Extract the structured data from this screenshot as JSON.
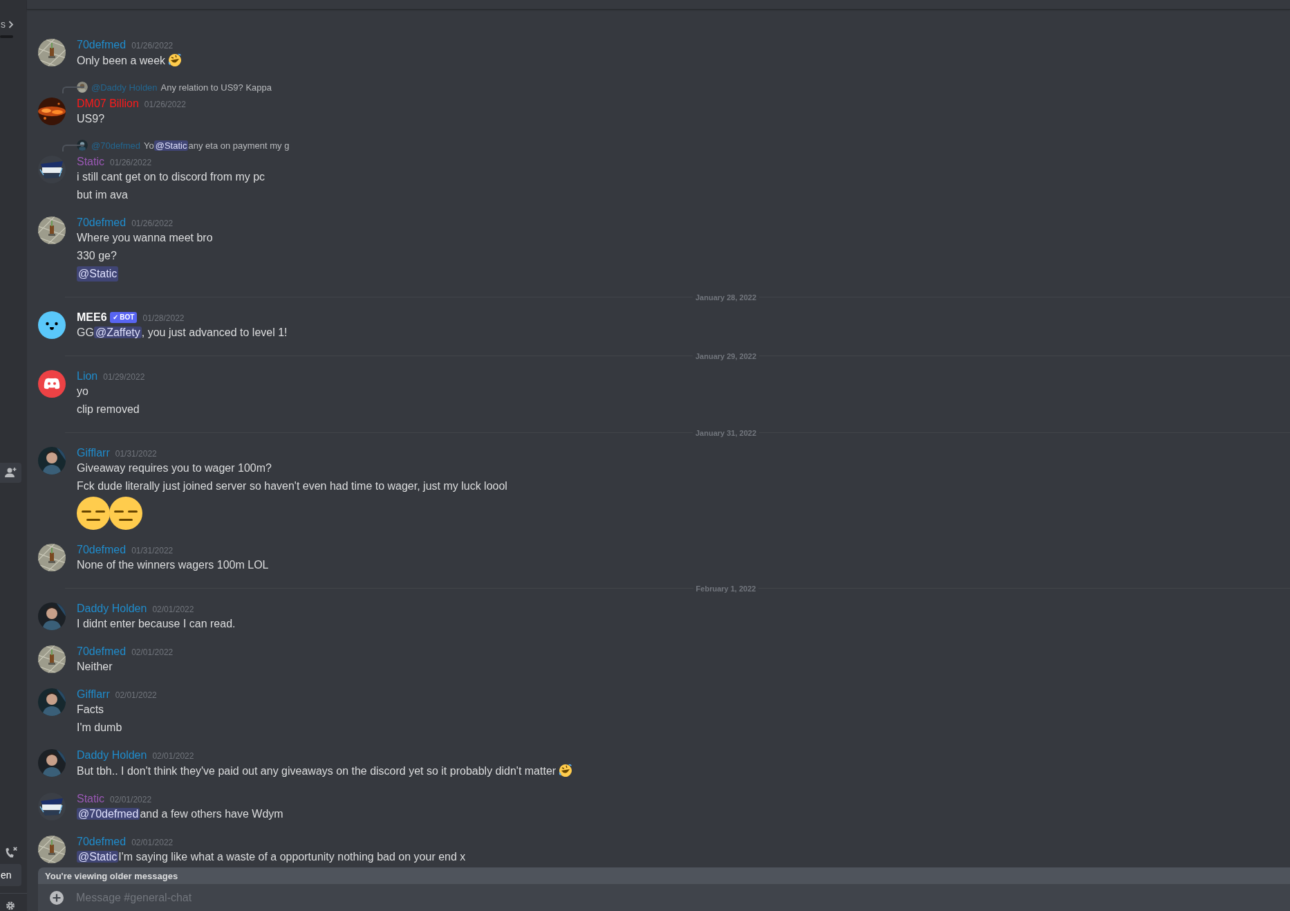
{
  "sidebar": {
    "header": "s",
    "footer_item": {
      "label": "en",
      "selected": true
    }
  },
  "messages": [
    {
      "kind": "message",
      "author": "70defmed",
      "color": "#1f8ccc",
      "timestamp": "01/26/2022",
      "avatar": {
        "kind": "picture"
      },
      "lines": [
        [
          {
            "kind": "text",
            "text": "Only been a week"
          },
          {
            "kind": "laugh_emoji"
          }
        ]
      ]
    },
    {
      "kind": "message",
      "author": "DM07 Billion",
      "color": "#ff1a1a",
      "timestamp": "01/26/2022",
      "avatar": {
        "kind": "picture"
      },
      "reply": {
        "author": "@Daddy Holden",
        "segments": [
          {
            "kind": "text",
            "text": "Any relation to US9? Kappa"
          }
        ]
      },
      "lines": [
        [
          {
            "kind": "text",
            "text": "US9?"
          }
        ]
      ]
    },
    {
      "kind": "message",
      "author": "Static",
      "color": "#9b59b6",
      "timestamp": "01/26/2022",
      "avatar": {
        "kind": "picture"
      },
      "reply": {
        "author": "@70defmed",
        "segments": [
          {
            "kind": "text",
            "text": "Yo"
          },
          {
            "kind": "mention",
            "text": "@Static"
          },
          {
            "kind": "text",
            "text": "any eta on payment my g"
          }
        ]
      },
      "lines": [
        [
          {
            "kind": "text",
            "text": "i still cant get on to discord from my pc"
          }
        ],
        [
          {
            "kind": "text",
            "text": "but im ava"
          }
        ]
      ]
    },
    {
      "kind": "message",
      "author": "70defmed",
      "color": "#1f8ccc",
      "timestamp": "01/26/2022",
      "avatar": {
        "kind": "picture"
      },
      "lines": [
        [
          {
            "kind": "text",
            "text": "Where you wanna meet bro"
          }
        ],
        [
          {
            "kind": "text",
            "text": "330 ge?"
          }
        ],
        [
          {
            "kind": "mention",
            "text": "@Static"
          }
        ]
      ]
    },
    {
      "kind": "divider",
      "label": "January 28, 2022"
    },
    {
      "kind": "message",
      "author": "MEE6",
      "color": "#ffffff",
      "badge": "✓ BOT",
      "timestamp": "01/28/2022",
      "avatar": {
        "kind": "bot"
      },
      "lines": [
        [
          {
            "kind": "text",
            "text": "GG"
          },
          {
            "kind": "mention",
            "text": "@Zaffety"
          },
          {
            "kind": "text",
            "text": ", you just advanced to level 1!"
          }
        ]
      ]
    },
    {
      "kind": "divider",
      "label": "January 29, 2022"
    },
    {
      "kind": "message",
      "author": "Lion",
      "color": "#1f8ccc",
      "timestamp": "01/29/2022",
      "avatar": {
        "kind": "default"
      },
      "lines": [
        [
          {
            "kind": "text",
            "text": "yo"
          }
        ],
        [
          {
            "kind": "text",
            "text": "clip removed"
          }
        ]
      ]
    },
    {
      "kind": "divider",
      "label": "January 31, 2022"
    },
    {
      "kind": "message",
      "author": "Gifflarr",
      "color": "#1f8ccc",
      "timestamp": "01/31/2022",
      "avatar": {
        "kind": "picture"
      },
      "lines": [
        [
          {
            "kind": "text",
            "text": "Giveaway requires you to wager 100m?"
          }
        ],
        [
          {
            "kind": "text",
            "text": "Fck dude literally just joined server so haven't even had time to wager, just my luck loool"
          }
        ],
        [
          {
            "kind": "big_meh_emoji"
          },
          {
            "kind": "big_meh_emoji"
          }
        ]
      ]
    },
    {
      "kind": "message",
      "author": "70defmed",
      "color": "#1f8ccc",
      "timestamp": "01/31/2022",
      "avatar": {
        "kind": "picture"
      },
      "lines": [
        [
          {
            "kind": "text",
            "text": "None of the winners wagers 100m LOL"
          }
        ]
      ]
    },
    {
      "kind": "divider",
      "label": "February 1, 2022"
    },
    {
      "kind": "message",
      "author": "Daddy Holden",
      "color": "#1f8ccc",
      "timestamp": "02/01/2022",
      "avatar": {
        "kind": "picture"
      },
      "lines": [
        [
          {
            "kind": "text",
            "text": "I didnt enter because I can read."
          }
        ]
      ]
    },
    {
      "kind": "message",
      "author": "70defmed",
      "color": "#1f8ccc",
      "timestamp": "02/01/2022",
      "avatar": {
        "kind": "picture"
      },
      "lines": [
        [
          {
            "kind": "text",
            "text": "Neither"
          }
        ]
      ]
    },
    {
      "kind": "message",
      "author": "Gifflarr",
      "color": "#1f8ccc",
      "timestamp": "02/01/2022",
      "avatar": {
        "kind": "picture"
      },
      "lines": [
        [
          {
            "kind": "text",
            "text": "Facts"
          }
        ],
        [
          {
            "kind": "text",
            "text": "I'm dumb"
          }
        ]
      ]
    },
    {
      "kind": "message",
      "author": "Daddy Holden",
      "color": "#1f8ccc",
      "timestamp": "02/01/2022",
      "avatar": {
        "kind": "picture"
      },
      "lines": [
        [
          {
            "kind": "text",
            "text": "But tbh.. I don't think they've paid out any giveaways on the discord yet so it probably didn't matter"
          },
          {
            "kind": "laugh_emoji"
          }
        ]
      ]
    },
    {
      "kind": "message",
      "author": "Static",
      "color": "#9b59b6",
      "timestamp": "02/01/2022",
      "avatar": {
        "kind": "picture"
      },
      "lines": [
        [
          {
            "kind": "mention",
            "text": "@70defmed"
          },
          {
            "kind": "text",
            "text": "and a few others have Wdym"
          }
        ]
      ]
    },
    {
      "kind": "message",
      "author": "70defmed",
      "color": "#1f8ccc",
      "timestamp": "02/01/2022",
      "avatar": {
        "kind": "picture"
      },
      "lines": [
        [
          {
            "kind": "mention",
            "text": "@Static"
          },
          {
            "kind": "text",
            "text": "I'm saying like what a waste of a opportunity nothing bad on your end x"
          }
        ]
      ]
    }
  ],
  "notice": "You're viewing older messages",
  "composer": {
    "placeholder": "Message #general-chat"
  }
}
